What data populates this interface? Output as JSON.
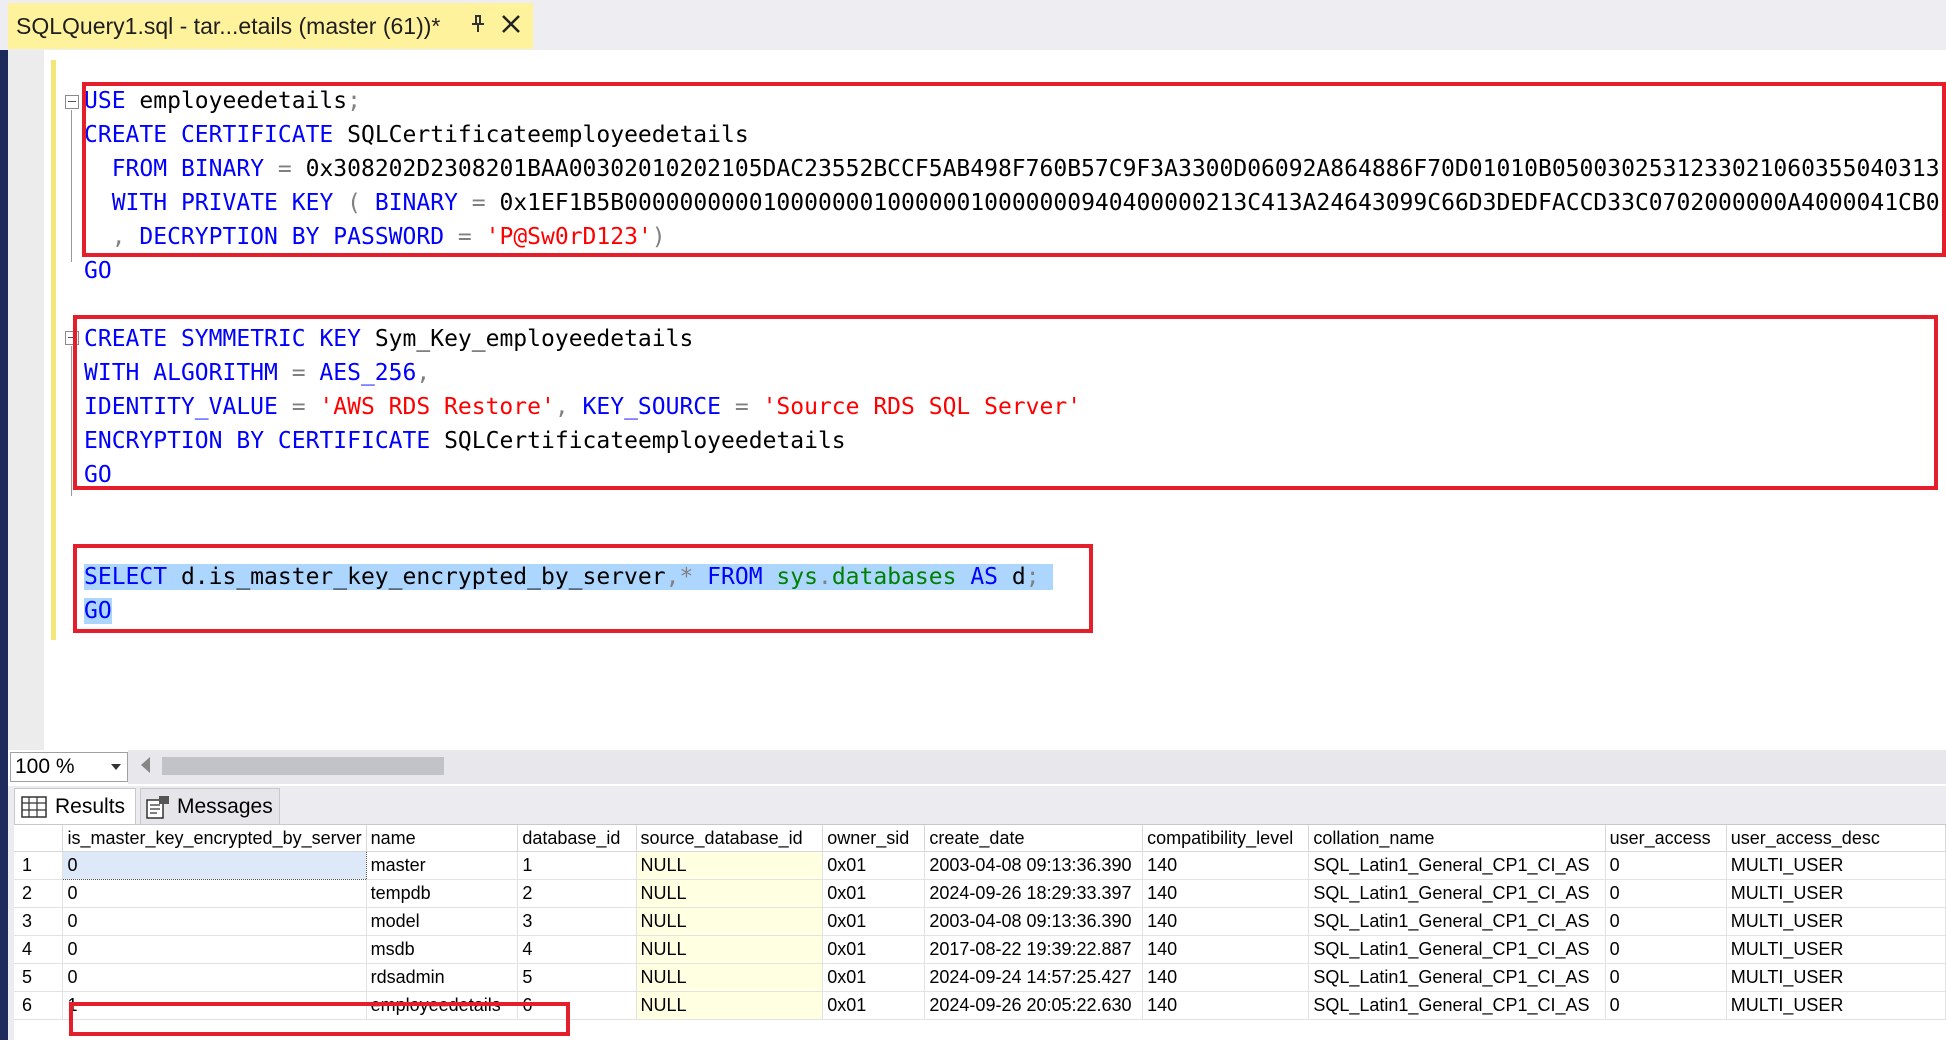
{
  "tab": {
    "title": "SQLQuery1.sql - tar...etails (master (61))*"
  },
  "editor": {
    "line1": {
      "kw": "USE",
      "rest": " employeedetails",
      "semi": ";"
    },
    "line2": {
      "kw1": "CREATE",
      "kw2": "CERTIFICATE",
      "name": " SQLCertificateemployeedetails"
    },
    "line3": {
      "kw1": "FROM",
      "kw2": "BINARY",
      "eq": " = ",
      "value": "0x308202D2308201BAA00302010202105DAC23552BCCF5AB498F760B57C9F3A3300D06092A864886F70D01010B0500302531233021060355040313"
    },
    "line4": {
      "kw1": "WITH",
      "kw2": "PRIVATE",
      "kw3": "KEY",
      "paren": " ( ",
      "kw4": "BINARY",
      "eq": " = ",
      "value": "0x1EF1B5B000000000010000000100000010000000940400000213C413A24643099C66D3DEDFACCD33C0702000000A4000041CB0"
    },
    "line5": {
      "comma": "  , ",
      "kw1": "DECRYPTION",
      "kw2": "BY",
      "kw3": "PASSWORD",
      "eq": " = ",
      "value": "'P@Sw0rD123'",
      "close": ")"
    },
    "line6": {
      "kw": "GO"
    },
    "line7": {
      "kw1": "CREATE",
      "kw2": "SYMMETRIC",
      "kw3": "KEY",
      "name": " Sym_Key_employeedetails"
    },
    "line8": {
      "kw1": "WITH",
      "kw2": "ALGORITHM",
      "eq": " = ",
      "kw3": "AES_256",
      "comma": ","
    },
    "line9": {
      "kw1": "IDENTITY_VALUE",
      "eq": " = ",
      "value1": "'AWS RDS Restore'",
      "comma": ", ",
      "kw2": "KEY_SOURCE",
      "eq2": " = ",
      "value2": "'Source RDS SQL Server'"
    },
    "line10": {
      "kw1": "ENCRYPTION",
      "kw2": "BY",
      "kw3": "CERTIFICATE",
      "name": " SQLCertificateemployeedetails"
    },
    "line11": {
      "kw": "GO"
    },
    "line12": {
      "kw1": "SELECT",
      "col": " d.is_master_key_encrypted_by_server",
      "comma": ",",
      "star": "*",
      "kw2": "FROM",
      "sys1": "sys",
      "dot": ".",
      "sys2": "databases",
      "kw3": "AS",
      "alias": " d",
      "semi": ";"
    },
    "line13": {
      "kw": "GO"
    }
  },
  "zoom": {
    "value": "100 %"
  },
  "results": {
    "tabs": {
      "results": "Results",
      "messages": "Messages"
    },
    "columns": [
      "is_master_key_encrypted_by_server",
      "name",
      "database_id",
      "source_database_id",
      "owner_sid",
      "create_date",
      "compatibility_level",
      "collation_name",
      "user_access",
      "user_access_desc"
    ],
    "rows": [
      [
        "1",
        "0",
        "master",
        "1",
        "NULL",
        "0x01",
        "2003-04-08 09:13:36.390",
        "140",
        "SQL_Latin1_General_CP1_CI_AS",
        "0",
        "MULTI_USER"
      ],
      [
        "2",
        "0",
        "tempdb",
        "2",
        "NULL",
        "0x01",
        "2024-09-26 18:29:33.397",
        "140",
        "SQL_Latin1_General_CP1_CI_AS",
        "0",
        "MULTI_USER"
      ],
      [
        "3",
        "0",
        "model",
        "3",
        "NULL",
        "0x01",
        "2003-04-08 09:13:36.390",
        "140",
        "SQL_Latin1_General_CP1_CI_AS",
        "0",
        "MULTI_USER"
      ],
      [
        "4",
        "0",
        "msdb",
        "4",
        "NULL",
        "0x01",
        "2017-08-22 19:39:22.887",
        "140",
        "SQL_Latin1_General_CP1_CI_AS",
        "0",
        "MULTI_USER"
      ],
      [
        "5",
        "0",
        "rdsadmin",
        "5",
        "NULL",
        "0x01",
        "2024-09-24 14:57:25.427",
        "140",
        "SQL_Latin1_General_CP1_CI_AS",
        "0",
        "MULTI_USER"
      ],
      [
        "6",
        "1",
        "employeedetails",
        "6",
        "NULL",
        "0x01",
        "2024-09-26 20:05:22.630",
        "140",
        "SQL_Latin1_General_CP1_CI_AS",
        "0",
        "MULTI_USER"
      ]
    ]
  }
}
